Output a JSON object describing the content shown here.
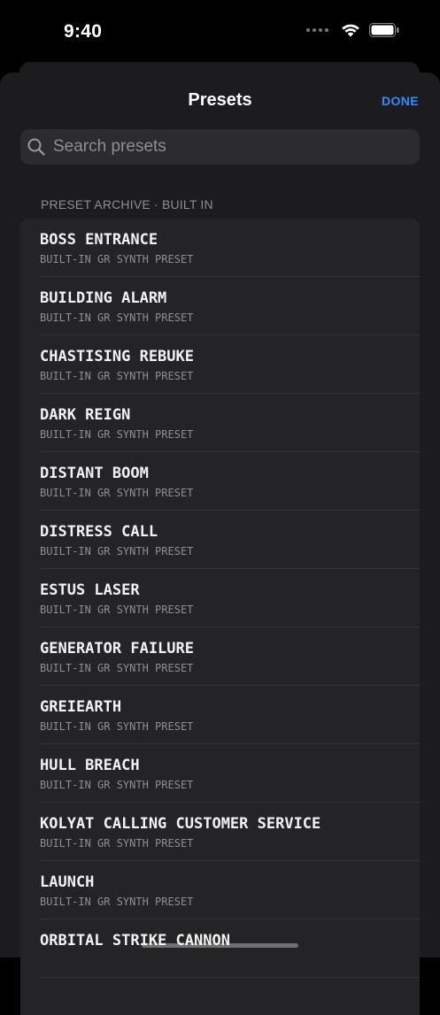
{
  "status_bar": {
    "time": "9:40"
  },
  "nav": {
    "title": "Presets",
    "done_label": "DONE"
  },
  "search": {
    "placeholder": "Search presets",
    "value": ""
  },
  "section": {
    "header": "PRESET ARCHIVE · BUILT IN"
  },
  "presets": [
    {
      "name": "BOSS ENTRANCE",
      "subtitle": "BUILT-IN GR SYNTH PRESET"
    },
    {
      "name": "BUILDING ALARM",
      "subtitle": "BUILT-IN GR SYNTH PRESET"
    },
    {
      "name": "CHASTISING REBUKE",
      "subtitle": "BUILT-IN GR SYNTH PRESET"
    },
    {
      "name": "DARK REIGN",
      "subtitle": "BUILT-IN GR SYNTH PRESET"
    },
    {
      "name": "DISTANT BOOM",
      "subtitle": "BUILT-IN GR SYNTH PRESET"
    },
    {
      "name": "DISTRESS CALL",
      "subtitle": "BUILT-IN GR SYNTH PRESET"
    },
    {
      "name": "ESTUS LASER",
      "subtitle": "BUILT-IN GR SYNTH PRESET"
    },
    {
      "name": "GENERATOR FAILURE",
      "subtitle": "BUILT-IN GR SYNTH PRESET"
    },
    {
      "name": "GREIEARTH",
      "subtitle": "BUILT-IN GR SYNTH PRESET"
    },
    {
      "name": "HULL BREACH",
      "subtitle": "BUILT-IN GR SYNTH PRESET"
    },
    {
      "name": "KOLYAT CALLING CUSTOMER SERVICE",
      "subtitle": "BUILT-IN GR SYNTH PRESET"
    },
    {
      "name": "LAUNCH",
      "subtitle": "BUILT-IN GR SYNTH PRESET"
    },
    {
      "name": "ORBITAL STRIKE CANNON",
      "subtitle": ""
    }
  ],
  "colors": {
    "accent": "#2f8cff",
    "sheet": "#1c1c1e",
    "list": "#242426"
  },
  "icons": {
    "search": "search-icon",
    "wifi": "wifi-icon",
    "battery": "battery-icon"
  }
}
